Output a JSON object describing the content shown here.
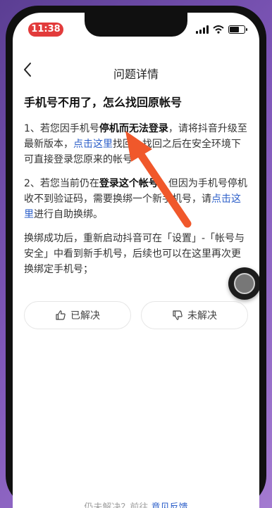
{
  "status_bar": {
    "time": "11:38",
    "battery_level": 0.7
  },
  "nav": {
    "back_icon": "chevron-left-icon",
    "title": "问题详情"
  },
  "question": {
    "title": "手机号不用了，怎么找回原帐号"
  },
  "paragraph1": {
    "prefix": "1、若您因手机号",
    "bold": "停机而无法登录",
    "mid": "，请将抖音升级至最新版本，",
    "link": "点击这里",
    "suffix": "找回，找回之后在安全环境下可直接登录您原来的帐号"
  },
  "paragraph2": {
    "prefix": "2、若您当前仍在",
    "bold": "登录这个帐号",
    "mid": "，但因为手机号停机收不到验证码，需要换绑一个新手机号，请",
    "link": "点击这里",
    "suffix": "进行自助换绑。"
  },
  "paragraph3": {
    "text": "换绑成功后，重新启动抖音可在「设置」-「帐号与安全」中看到新手机号，后续也可以在这里再次更换绑定手机号；"
  },
  "feedback": {
    "solved_label": "已解决",
    "solved_icon": "thumbs-up-icon",
    "unsolved_label": "未解决",
    "unsolved_icon": "thumbs-down-icon"
  },
  "footer": {
    "prefix": "仍未解决？前往",
    "link": "意见反馈"
  },
  "colors": {
    "link": "#2c5fc9",
    "arrow": "#f0582b",
    "time_badge": "#e23b3b"
  }
}
